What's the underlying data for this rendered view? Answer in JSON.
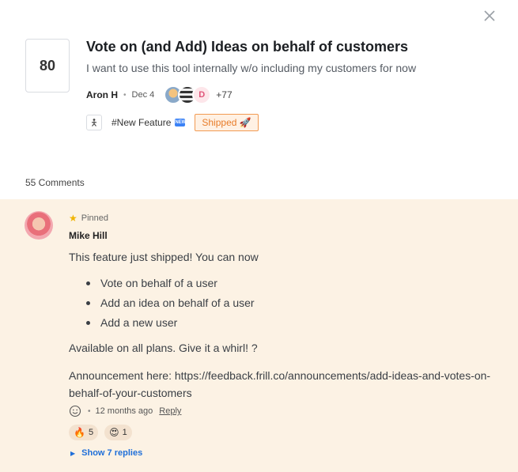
{
  "post": {
    "votes": "80",
    "title": "Vote on (and Add) Ideas on behalf of customers",
    "description": "I want to use this tool internally w/o including my customers for now",
    "author": "Aron H",
    "date": "Dec 4",
    "avatar_initial": "D",
    "more_voters": "+77",
    "tag": "#New Feature",
    "tag_badge": "NEW",
    "status": "Shipped 🚀",
    "accent_color": "#e87c2a"
  },
  "comments_count": "55 Comments",
  "comment": {
    "pinned_label": "Pinned",
    "author": "Mike Hill",
    "intro": "This feature just shipped! You can now",
    "bullets": [
      "Vote on behalf of a user",
      "Add an idea on behalf of a user",
      "Add a new user"
    ],
    "availability": "Available on all plans. Give it a whirl! ?",
    "announcement": "Announcement here: https://feedback.frill.co/announcements/add-ideas-and-votes-on-behalf-of-your-customers",
    "time": "12 months ago",
    "reply_label": "Reply",
    "reactions": [
      {
        "emoji": "🔥",
        "count": "5"
      },
      {
        "emoji": "😍",
        "count": "1"
      }
    ],
    "show_replies": "Show 7 replies"
  },
  "icons": {
    "close": "close-icon",
    "tag": "person-icon",
    "pin": "star-icon",
    "emoji": "smile-icon"
  }
}
